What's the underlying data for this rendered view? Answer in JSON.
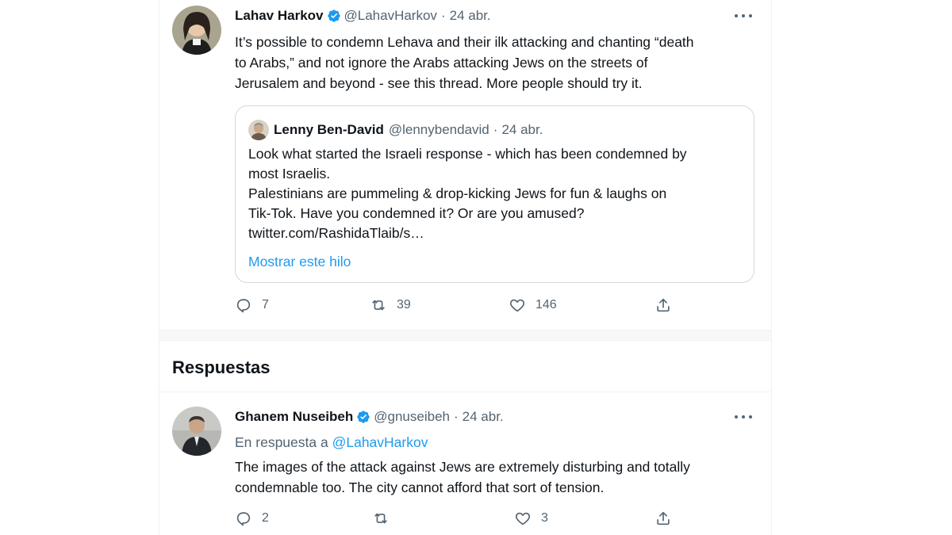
{
  "main_tweet": {
    "name": "Lahav Harkov",
    "handle": "@LahavHarkov",
    "separator": "·",
    "date": "24 abr.",
    "lines": [
      "It’s possible to condemn Lehava and their ilk attacking and chanting “death",
      "to Arabs,” and not ignore the Arabs attacking Jews on the streets of",
      "Jerusalem and beyond - see this thread. More people should try it."
    ],
    "quote": {
      "name": "Lenny Ben-David",
      "handle": "@lennybendavid",
      "separator": "·",
      "date": "24 abr.",
      "lines": [
        "Look what started the Israeli response - which has been condemned by",
        "most Israelis.",
        "Palestinians are pummeling & drop-kicking Jews for fun & laughs on",
        "Tik-Tok. Have you condemned it? Or are you amused?",
        "twitter.com/RashidaTlaib/s…"
      ],
      "show_thread": "Mostrar este hilo"
    },
    "actions": {
      "replies": "7",
      "retweets": "39",
      "likes": "146"
    }
  },
  "section_title": "Respuestas",
  "reply_tweet": {
    "name": "Ghanem Nuseibeh",
    "handle": "@gnuseibeh",
    "separator": "·",
    "date": "24 abr.",
    "reply_prefix": "En respuesta a",
    "reply_to": "@LahavHarkov",
    "lines": [
      "The images of the attack against Jews are extremely disturbing and totally",
      "condemnable too. The city cannot afford that sort of tension."
    ],
    "actions": {
      "replies": "2",
      "retweets": "",
      "likes": "3"
    }
  },
  "colors": {
    "accent": "#1d9bf0",
    "secondary_text": "#536471",
    "border": "#cfd9de"
  },
  "icons": [
    "verified-badge-icon",
    "more-icon",
    "reply-icon",
    "retweet-icon",
    "like-icon",
    "share-icon"
  ]
}
